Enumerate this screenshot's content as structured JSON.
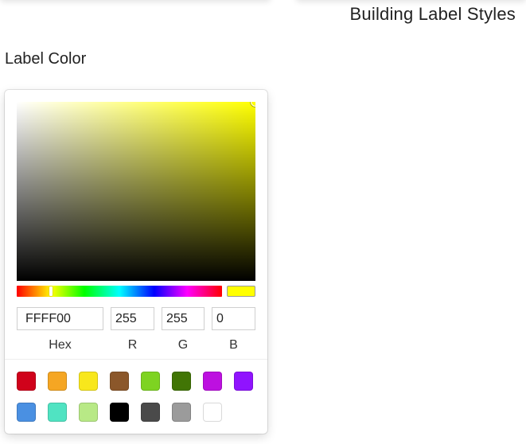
{
  "panel": {
    "title": "Building Label Styles",
    "field_label": "Label Color"
  },
  "color_picker": {
    "current_hex": "FFFF00",
    "current_color": "#ffff00",
    "hue_color": "#ffff00",
    "hue_degrees": 60,
    "saturation_percent": 100,
    "value_percent": 100,
    "inputs": {
      "hex": {
        "value": "FFFF00",
        "label": "Hex"
      },
      "r": {
        "value": "255",
        "label": "R"
      },
      "g": {
        "value": "255",
        "label": "G"
      },
      "b": {
        "value": "0",
        "label": "B"
      }
    },
    "preset_swatches": [
      "#d0021b",
      "#f5a623",
      "#f8e71c",
      "#8b572a",
      "#7ed321",
      "#417505",
      "#bd10e0",
      "#9013fe",
      "#4a90e2",
      "#50e3c2",
      "#b8e986",
      "#000000",
      "#4a4a4a",
      "#9b9b9b",
      "#ffffff"
    ]
  }
}
